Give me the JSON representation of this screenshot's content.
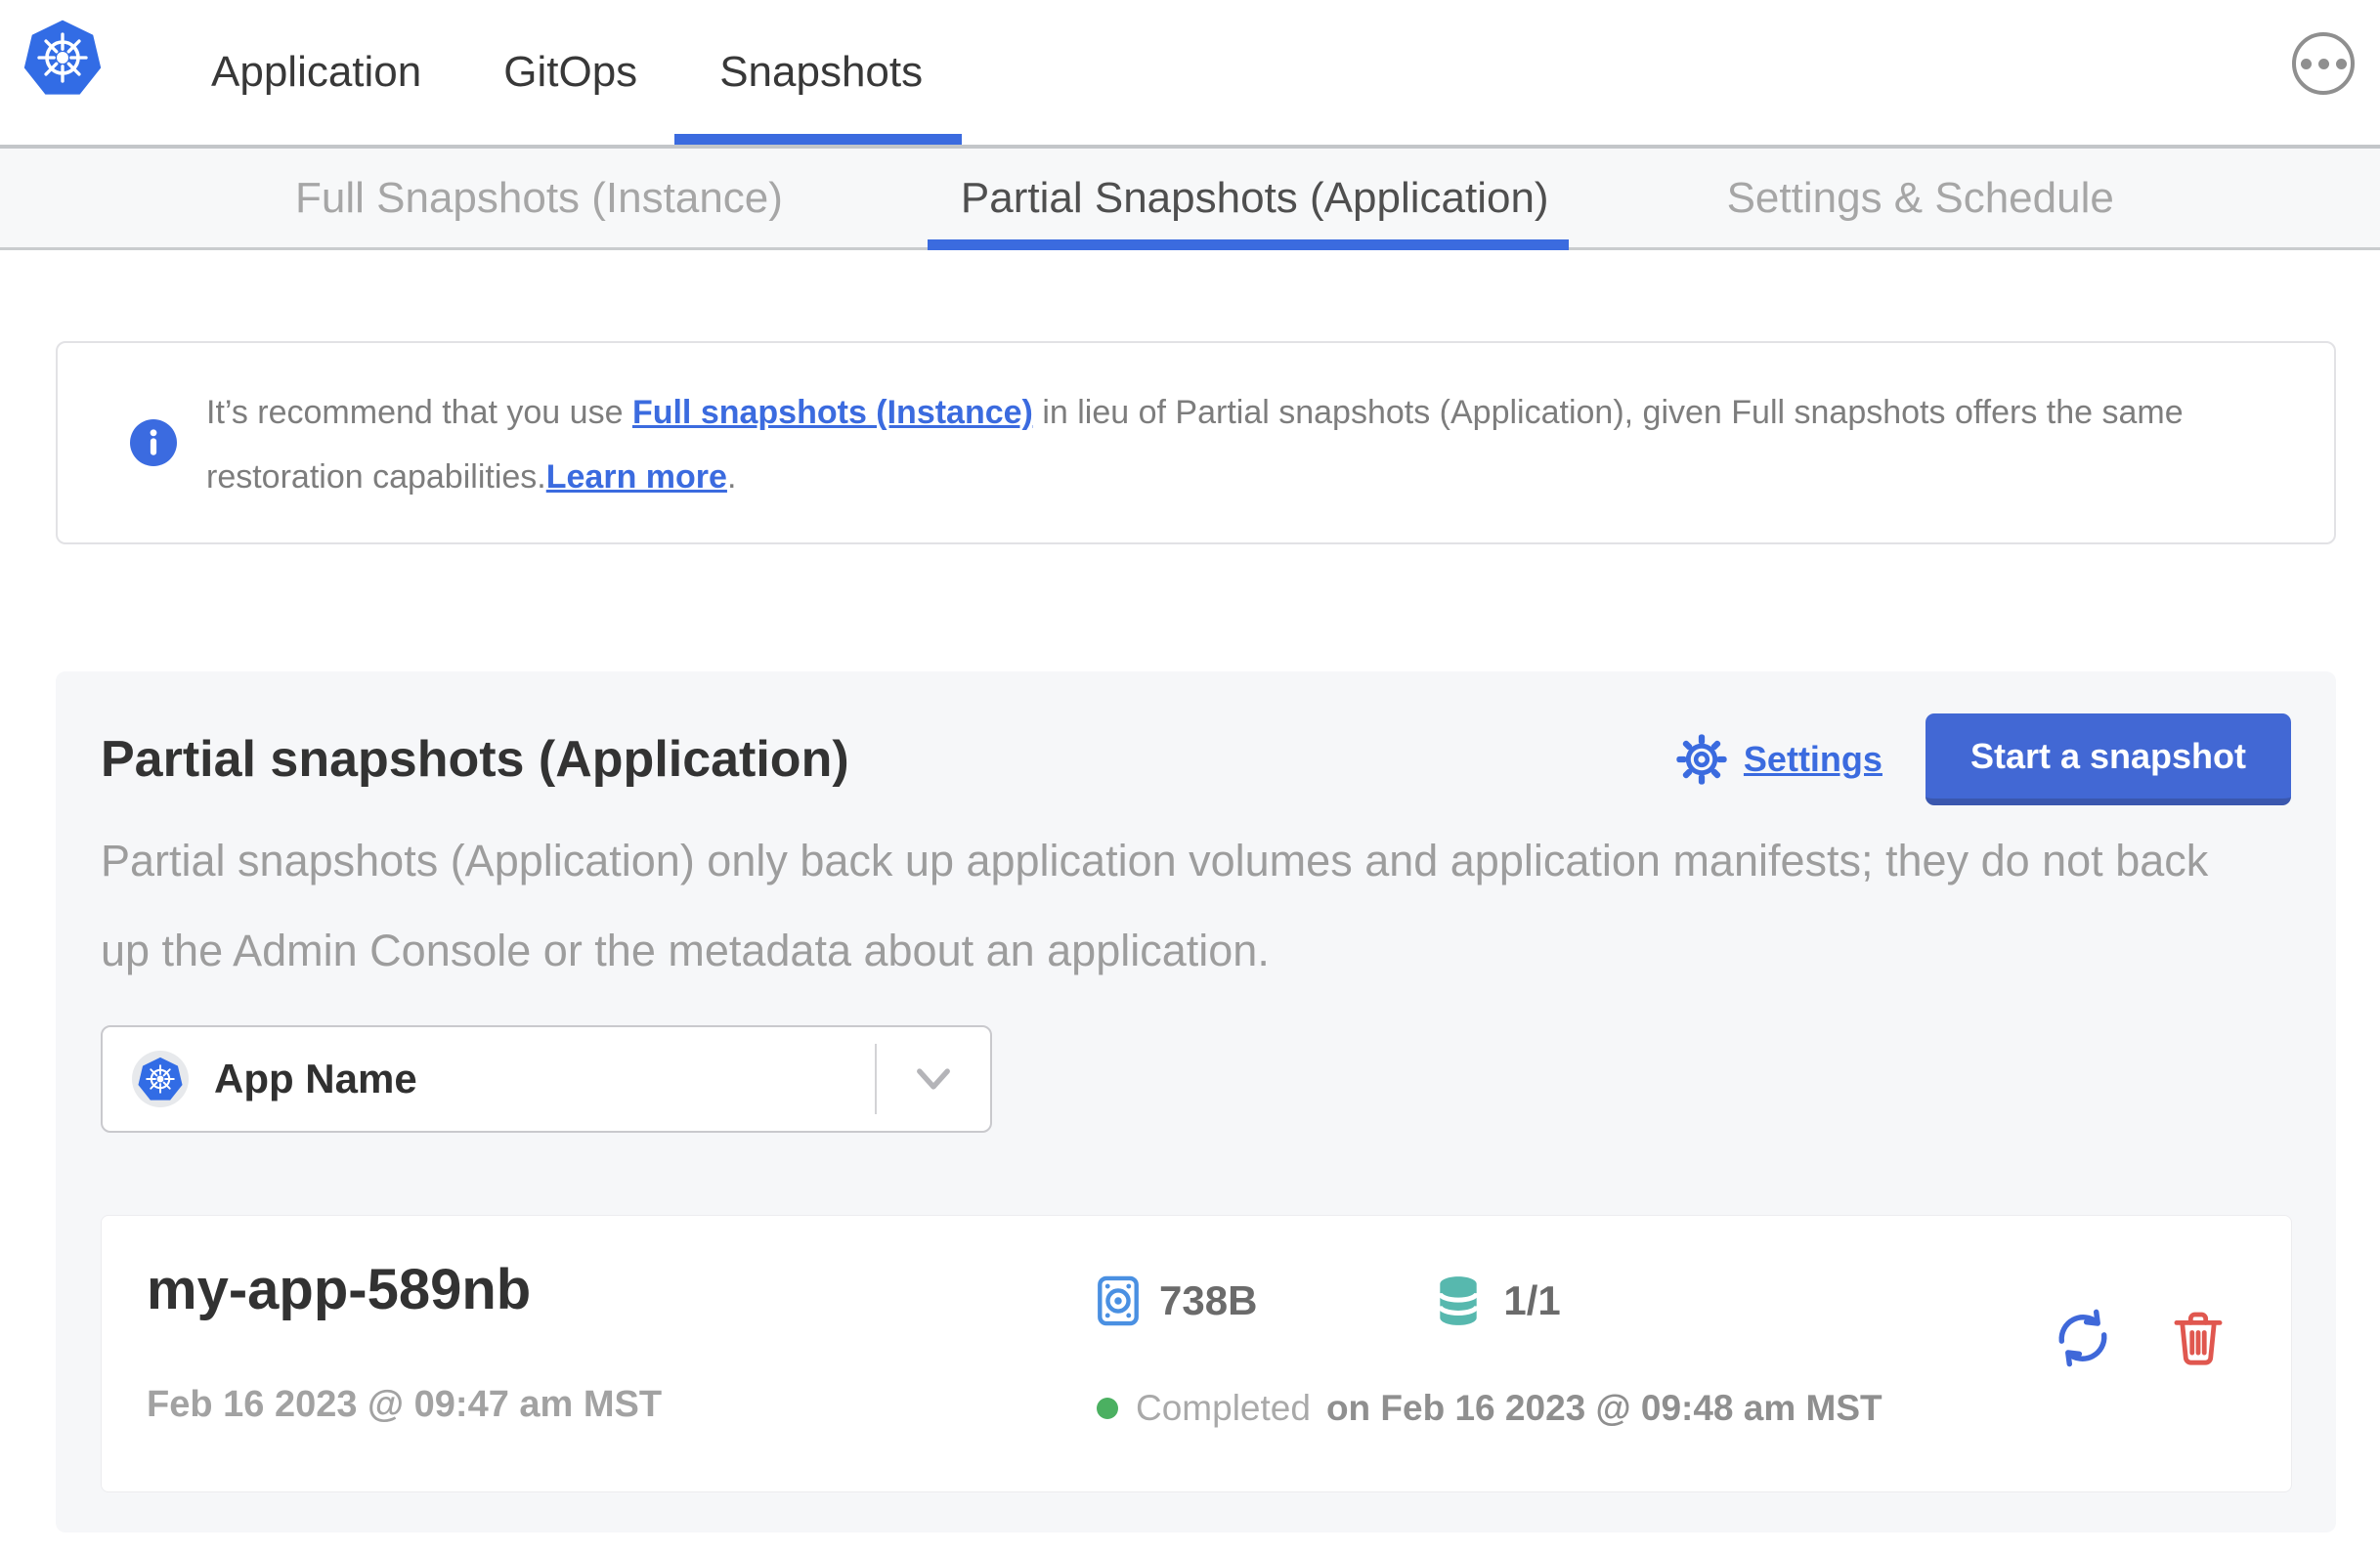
{
  "colors": {
    "accent_blue": "#3b6bdf",
    "k8s_blue": "#326ce5",
    "button_blue": "#4268d4",
    "disk_blue": "#4a90e2",
    "teal": "#57b8ae",
    "green": "#4bb061",
    "red": "#e0574f"
  },
  "icons": {
    "logo": "kubernetes-logo-icon",
    "more": "ellipsis-circle-icon",
    "banner": "info-icon",
    "settings": "gear-icon",
    "app_selector": "kubernetes-app-icon",
    "caret": "chevron-down-icon",
    "size": "disk-icon",
    "volumes": "database-icon",
    "status": "green-dot",
    "restore": "restore-icon",
    "delete": "trash-icon"
  },
  "top_nav": {
    "items": [
      {
        "label": "Application"
      },
      {
        "label": "GitOps"
      },
      {
        "label": "Snapshots"
      }
    ]
  },
  "subnav": {
    "tabs": [
      {
        "label": "Full Snapshots (Instance)"
      },
      {
        "label": "Partial Snapshots (Application)"
      },
      {
        "label": "Settings & Schedule"
      }
    ]
  },
  "info_banner": {
    "text_start": "It’s recommend that you use ",
    "link_full_snapshots": "Full snapshots (Instance)",
    "text_middle": " in lieu of Partial snapshots (Application), given Full snapshots offers the same restoration capabilities.",
    "link_learn_more": "Learn more",
    "text_end": "."
  },
  "panel": {
    "title": "Partial snapshots (Application)",
    "settings_link": "Settings",
    "start_snapshot_button": "Start a snapshot",
    "description": "Partial snapshots (Application) only back up application volumes and application manifests; they do not back up the Admin Console or the metadata about an application.",
    "app_selector": {
      "selected": "App Name"
    },
    "snapshots": [
      {
        "name": "my-app-589nb",
        "started_at": "Feb 16 2023 @ 09:47 am MST",
        "size": "738B",
        "volumes": "1/1",
        "status": "Completed",
        "finished_at": "on Feb 16 2023 @ 09:48 am MST"
      }
    ]
  }
}
